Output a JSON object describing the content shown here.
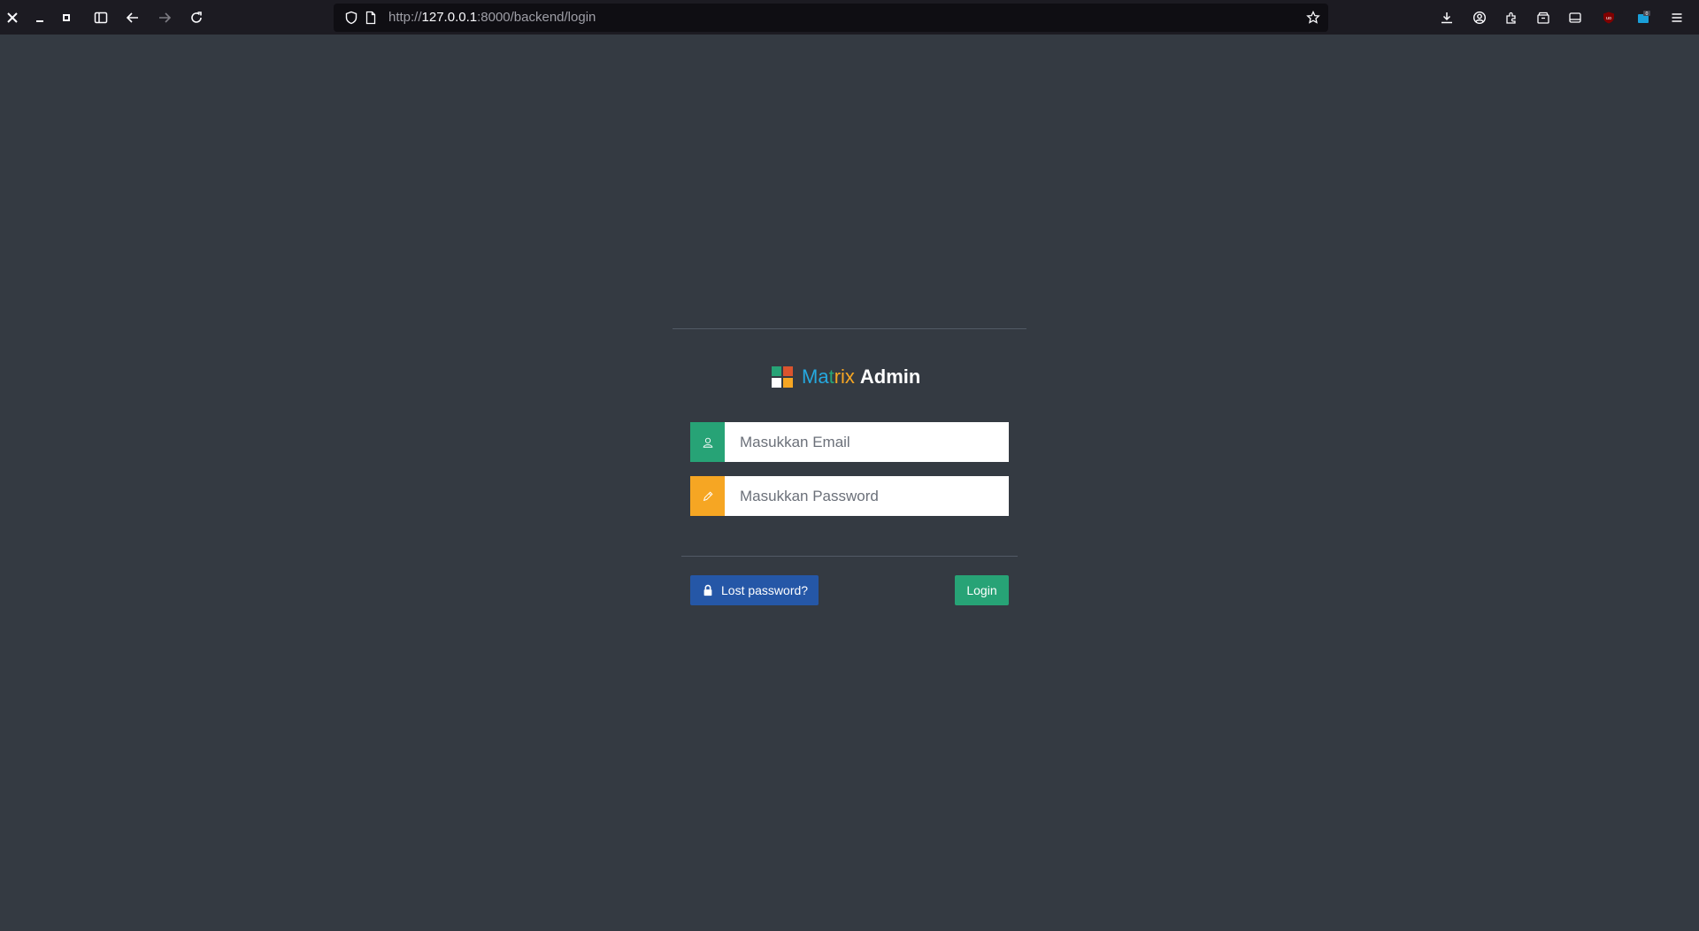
{
  "browser": {
    "url_prefix": "http://",
    "url_host": "127.0.0.1",
    "url_rest": ":8000/backend/login"
  },
  "logo": {
    "letters": [
      {
        "char": "M",
        "color": "#25a9e0"
      },
      {
        "char": "a",
        "color": "#25a9e0"
      },
      {
        "char": "t",
        "color": "#27a376"
      },
      {
        "char": "r",
        "color": "#f6a623"
      },
      {
        "char": "i",
        "color": "#f6a623"
      },
      {
        "char": "x",
        "color": "#f6a623"
      }
    ],
    "bold_text": "Admin",
    "mark_colors": [
      "#27a376",
      "#da542e",
      "#ffffff",
      "#f6a623"
    ]
  },
  "form": {
    "email_placeholder": "Masukkan Email",
    "email_icon": "user-icon",
    "email_icon_bg": "#27a376",
    "password_placeholder": "Masukkan Password",
    "password_icon": "pencil-icon",
    "password_icon_bg": "#f6a623"
  },
  "actions": {
    "lost_password_label": "Lost password?",
    "lost_password_icon": "lock-icon",
    "lost_password_bg": "#2557a7",
    "login_label": "Login",
    "login_bg": "#27a376"
  },
  "colors": {
    "page_bg": "#343a42",
    "browser_bg": "#1c1b22"
  }
}
